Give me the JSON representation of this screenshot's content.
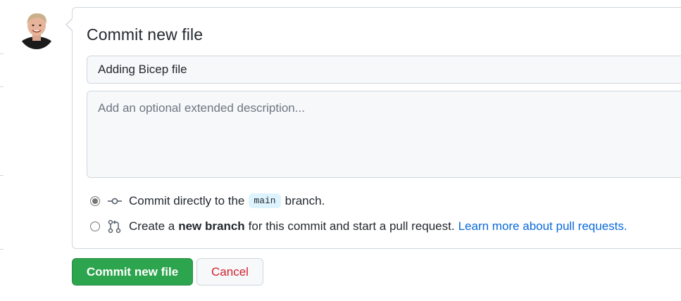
{
  "form": {
    "title": "Commit new file",
    "summary_value": "Adding Bicep file",
    "description_placeholder": "Add an optional extended description...",
    "description_value": ""
  },
  "options": {
    "direct": {
      "checked": true,
      "icon": "git-commit-icon",
      "text_before": "Commit directly to the",
      "branch": "main",
      "text_after": "branch."
    },
    "new_branch": {
      "checked": false,
      "icon": "git-pull-request-icon",
      "text_before": "Create a",
      "bold": "new branch",
      "text_after": "for this commit and start a pull request.",
      "link": "Learn more about pull requests."
    }
  },
  "buttons": {
    "commit": "Commit new file",
    "cancel": "Cancel"
  },
  "colors": {
    "commit_green": "#2da44e",
    "cancel_red": "#cf222e",
    "link_blue": "#0969da"
  }
}
